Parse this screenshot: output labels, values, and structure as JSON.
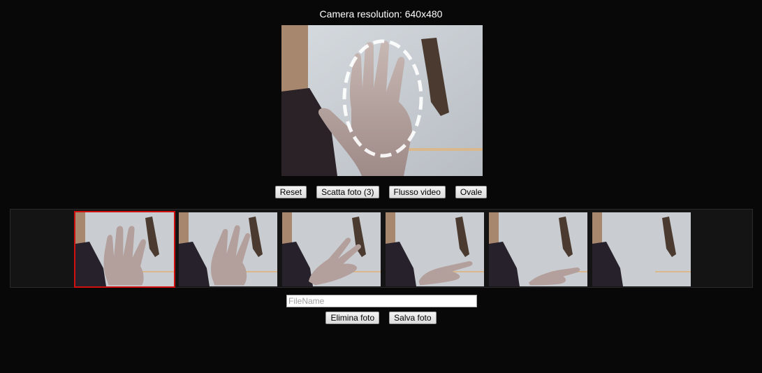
{
  "camera": {
    "resolution_text": "Camera resolution: 640x480"
  },
  "controls": {
    "reset_label": "Reset",
    "capture_label": "Scatta foto (3)",
    "stream_label": "Flusso video",
    "oval_label": "Ovale"
  },
  "gallery": {
    "selected_index": 0,
    "photos": [
      {
        "pose": "open-hand-front"
      },
      {
        "pose": "open-hand-tilted"
      },
      {
        "pose": "hand-tilted-more"
      },
      {
        "pose": "hand-sideways"
      },
      {
        "pose": "hand-sideways-low"
      },
      {
        "pose": "empty-background"
      }
    ]
  },
  "file": {
    "placeholder": "FileName",
    "value": ""
  },
  "actions": {
    "delete_label": "Elimina foto",
    "save_label": "Salva foto"
  },
  "colors": {
    "background": "#080808",
    "selected_border": "#d10f0f",
    "oval_overlay": "#ffffff"
  }
}
